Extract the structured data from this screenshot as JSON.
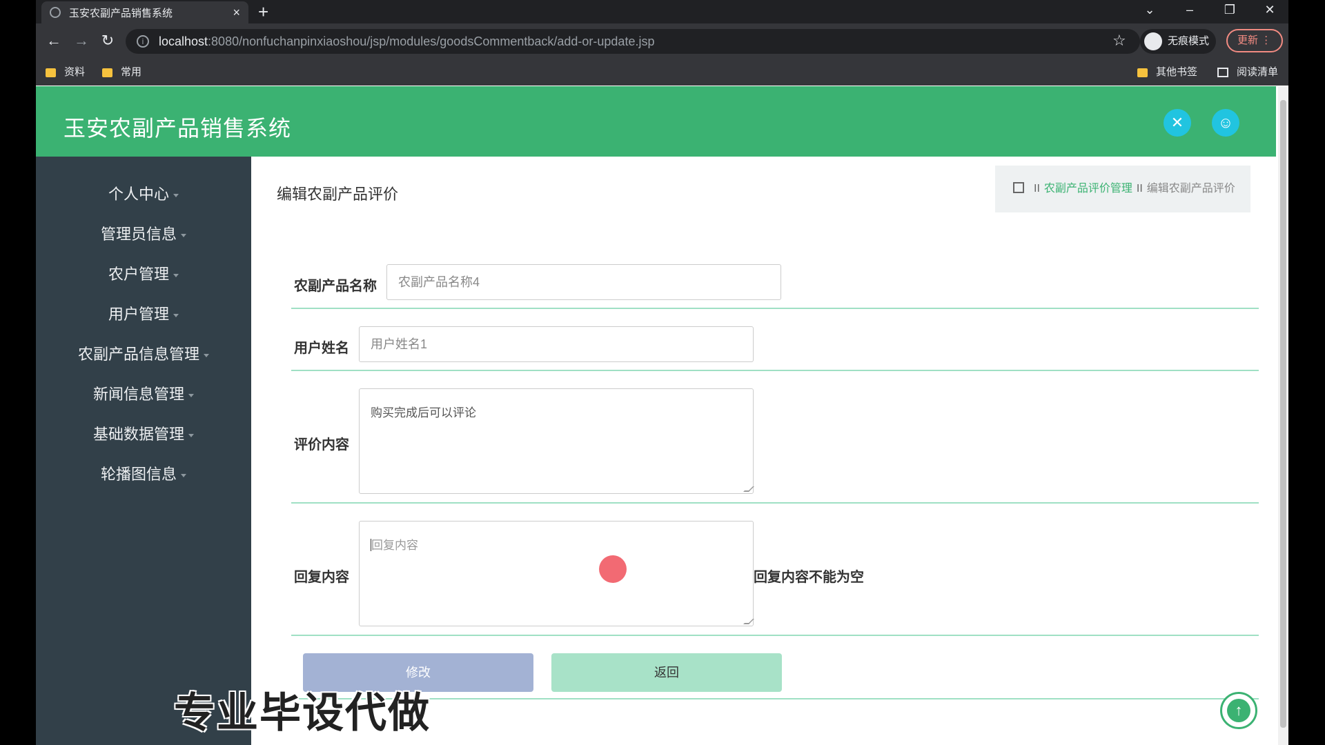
{
  "browser": {
    "tab_title": "玉安农副产品销售系统",
    "tab_close": "×",
    "new_tab": "+",
    "url_host": "localhost",
    "url_rest": ":8080/nonfuchanpinxiaoshou/jsp/modules/goodsCommentback/add-or-update.jsp",
    "incognito_label": "无痕模式",
    "update_label": "更新",
    "bookmarks": [
      "资料",
      "常用"
    ],
    "other_bookmarks": "其他书签",
    "reading_list": "阅读清单"
  },
  "app": {
    "title": "玉安农副产品销售系统"
  },
  "sidebar": {
    "items": [
      {
        "label": "个人中心"
      },
      {
        "label": "管理员信息"
      },
      {
        "label": "农户管理"
      },
      {
        "label": "用户管理"
      },
      {
        "label": "农副产品信息管理"
      },
      {
        "label": "新闻信息管理"
      },
      {
        "label": "基础数据管理"
      },
      {
        "label": "轮播图信息"
      }
    ]
  },
  "page": {
    "title": "编辑农副产品评价",
    "breadcrumb": {
      "sep": "II",
      "parent": "农副产品评价管理",
      "current": "编辑农副产品评价"
    }
  },
  "form": {
    "product_name": {
      "label": "农副产品名称",
      "value": "农副产品名称4"
    },
    "user_name": {
      "label": "用户姓名",
      "value": "用户姓名1"
    },
    "comment": {
      "label": "评价内容",
      "value": "购买完成后可以评论"
    },
    "reply": {
      "label": "回复内容",
      "placeholder": "回复内容",
      "error": "回复内容不能为空"
    },
    "submit_label": "修改",
    "back_label": "返回"
  },
  "overlay": {
    "watermark": "专业毕设代做"
  },
  "colors": {
    "header": "#3bb272",
    "sidebar": "#324049",
    "accent": "#21c4e0"
  }
}
